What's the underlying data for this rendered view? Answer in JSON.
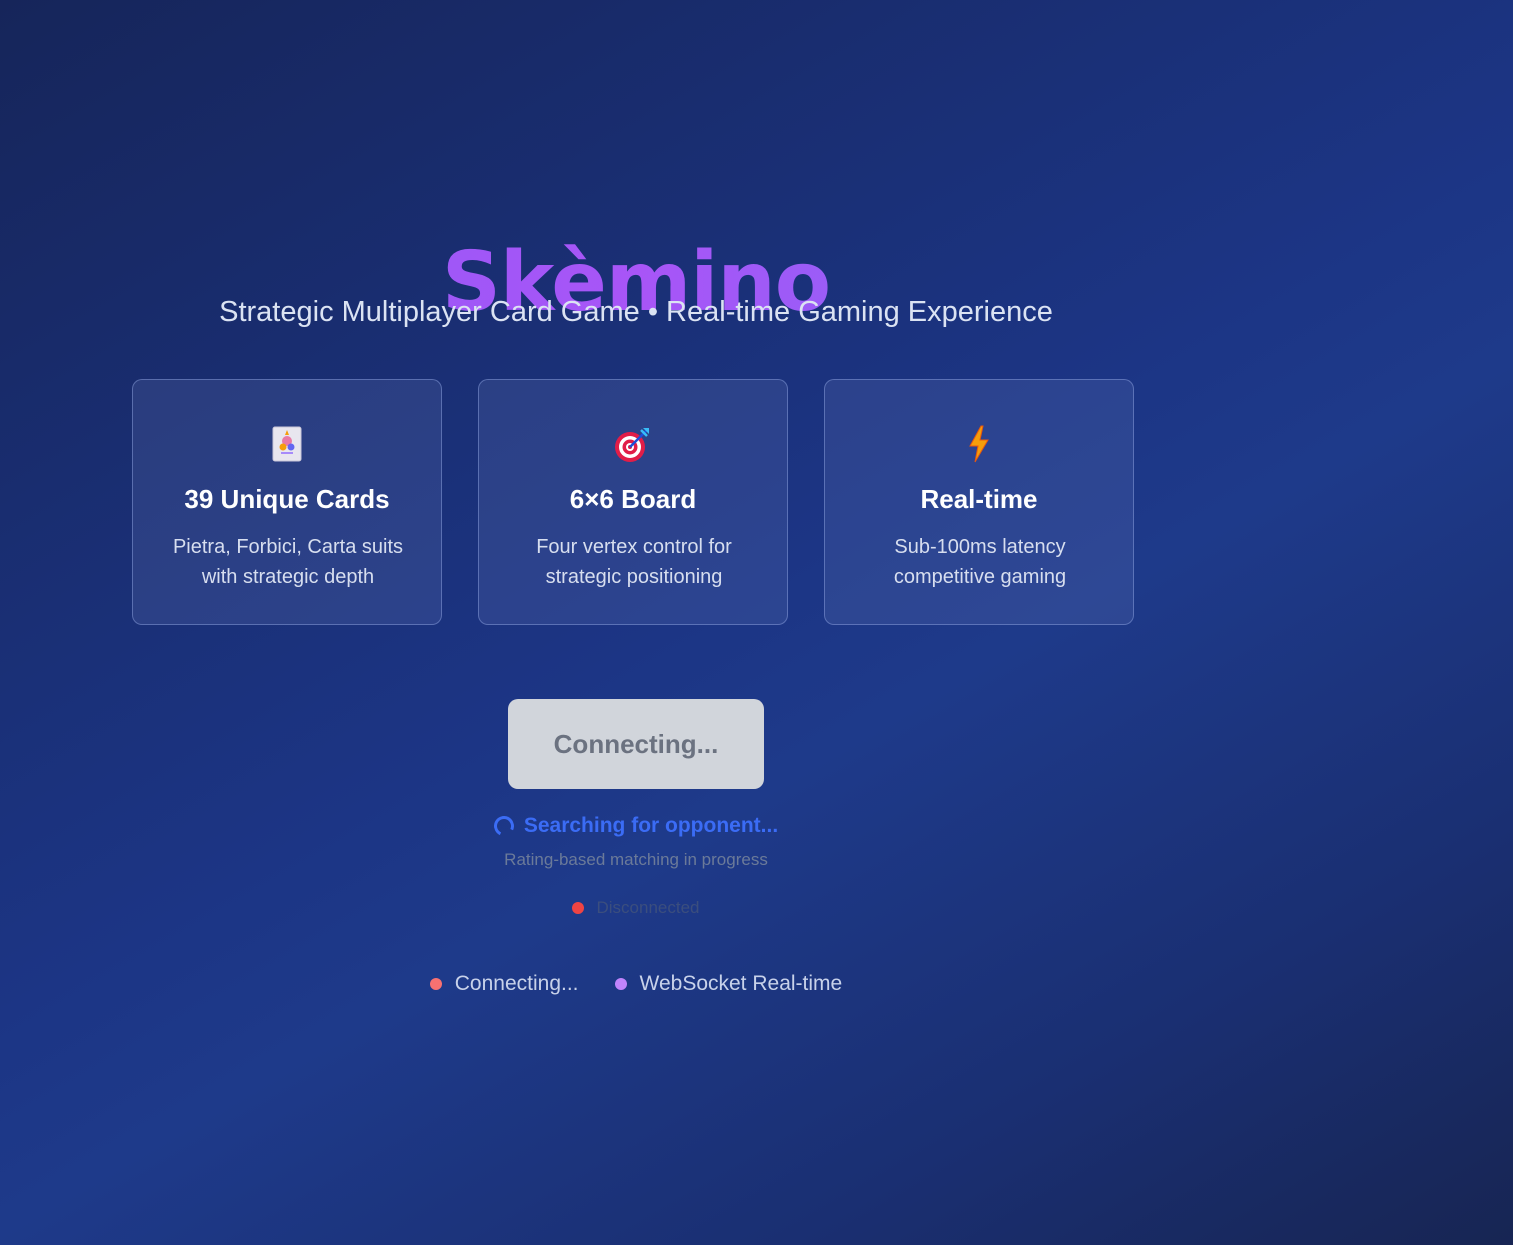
{
  "hero": {
    "title": "Skèmino",
    "subtitle": "Strategic Multiplayer Card Game • Real-time Gaming Experience"
  },
  "features": [
    {
      "icon": "playing-cards-icon",
      "title": "39 Unique Cards",
      "description": "Pietra, Forbici, Carta suits with strategic depth"
    },
    {
      "icon": "target-icon",
      "title": "6×6 Board",
      "description": "Four vertex control for strategic positioning"
    },
    {
      "icon": "lightning-icon",
      "title": "Real-time",
      "description": "Sub-100ms latency competitive gaming"
    }
  ],
  "matchmaking": {
    "button_label": "Connecting...",
    "searching_text": "Searching for opponent...",
    "rating_text": "Rating-based matching in progress",
    "status_text": "Disconnected",
    "status_color": "#ef4444"
  },
  "footer": {
    "connection_label": "Connecting...",
    "connection_color": "#f87171",
    "transport_label": "WebSocket Real-time",
    "transport_color": "#c084fc"
  },
  "colors": {
    "title_gradient_start": "#8b5cf6",
    "title_gradient_end": "#a855f7",
    "searching": "#3b6cf5",
    "button_bg": "#d1d5db"
  }
}
